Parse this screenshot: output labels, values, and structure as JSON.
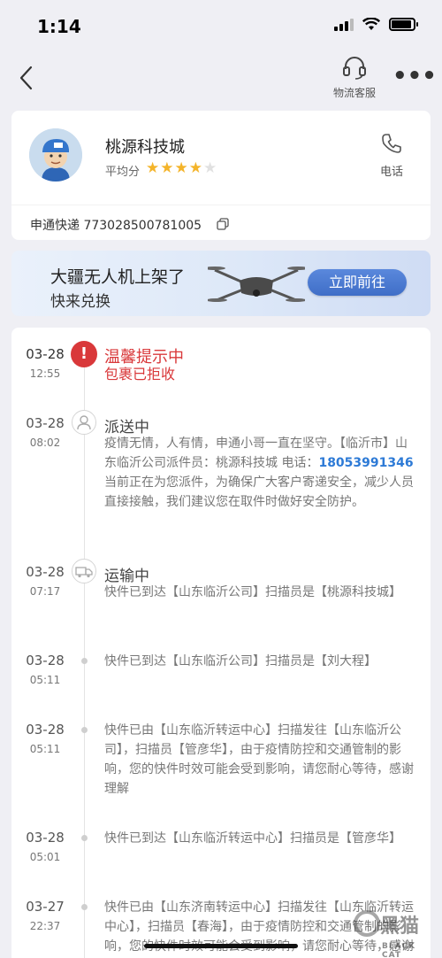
{
  "status_bar": {
    "time": "1:14"
  },
  "nav": {
    "customer_service_label": "物流客服",
    "more_label": "•••"
  },
  "shop": {
    "name": "桃源科技城",
    "rating_label": "平均分",
    "rating_stars": 4,
    "rating_max": 5,
    "phone_label": "电话",
    "carrier": "申通快递",
    "tracking_number": "773028500781005",
    "tracking_text": "申通快递 773028500781005"
  },
  "banner": {
    "title": "大疆无人机上架了",
    "subtitle": "快来兑换",
    "button_label": "立即前往"
  },
  "timeline": [
    {
      "date": "03-28",
      "time": "12:55",
      "title": "温馨提示中",
      "desc": "包裹已拒收",
      "marker": "alert-icon"
    },
    {
      "date": "03-28",
      "time": "08:02",
      "title": "派送中",
      "desc_pre": "疫情无情，人有情，申通小哥一直在坚守。【临沂市】山东临沂公司派件员：桃源科技城 电话：",
      "phone": "18053991346",
      "desc_post": " 当前正在为您派件，为确保广大客户寄递安全，减少人员直接接触，我们建议您在取件时做好安全防护。",
      "marker": "courier-icon"
    },
    {
      "date": "03-28",
      "time": "07:17",
      "title": "运输中",
      "desc": "快件已到达【山东临沂公司】扫描员是【桃源科技城】",
      "marker": "truck-icon"
    },
    {
      "date": "03-28",
      "time": "05:11",
      "desc": "快件已到达【山东临沂公司】扫描员是【刘大程】",
      "marker": "dot"
    },
    {
      "date": "03-28",
      "time": "05:11",
      "desc": "快件已由【山东临沂转运中心】扫描发往【山东临沂公司】，扫描员【管彦华】，由于疫情防控和交通管制的影响，您的快件时效可能会受到影响，请您耐心等待，感谢理解",
      "marker": "dot"
    },
    {
      "date": "03-28",
      "time": "05:01",
      "desc": "快件已到达【山东临沂转运中心】扫描员是【管彦华】",
      "marker": "dot"
    },
    {
      "date": "03-27",
      "time": "22:37",
      "desc": "快件已由【山东济南转运中心】扫描发往【山东临沂转运中心】，扫描员【春海】，由于疫情防控和交通管制的影响，您的快件时效可能会受到影响，请您耐心等待，感谢理解",
      "marker": "dot"
    }
  ],
  "watermark": {
    "text": "黑猫",
    "sub": "BLACK CAT"
  },
  "colors": {
    "alert": "#d9383a",
    "link": "#2d7ad6",
    "star": "#f4b42a",
    "banner_button": "#4a7bd2"
  }
}
